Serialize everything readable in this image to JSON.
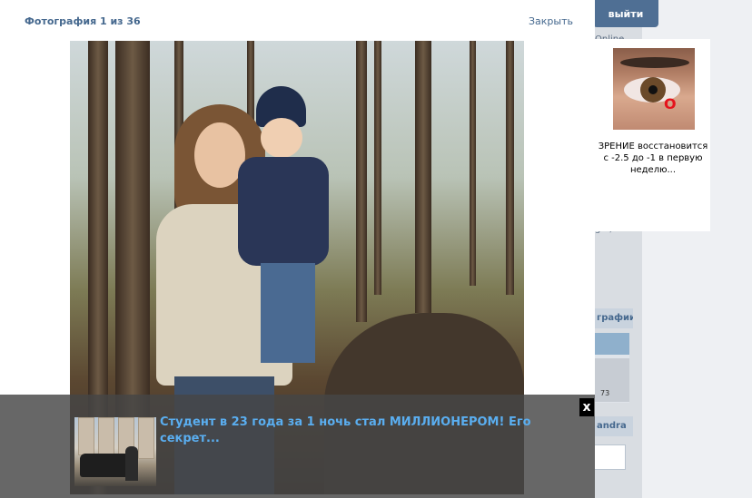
{
  "header": {
    "logout_label": "выйти"
  },
  "modal": {
    "title": "Фотография 1 из 36",
    "close_label": "Закрыть"
  },
  "bottom_ad": {
    "close_symbol": "x",
    "text": "Студент в 23 года за 1 ночь стал МИЛЛИОНЕРОМ! Его секрет..."
  },
  "side_ad": {
    "text": "ЗРЕНИЕ восстановится с -2.5 до -1 в первую неделю...",
    "mark": "O"
  },
  "background_page": {
    "stub_text_1": "Online",
    "stub_text_2": "рафи",
    "stub_text_3": "ga )",
    "section_photos": "графии",
    "section_user": "andra",
    "thumb_count": "73"
  },
  "colors": {
    "link_blue": "#45688e",
    "ad_text": "#5aaef0",
    "accent_button": "#4f6f94"
  }
}
